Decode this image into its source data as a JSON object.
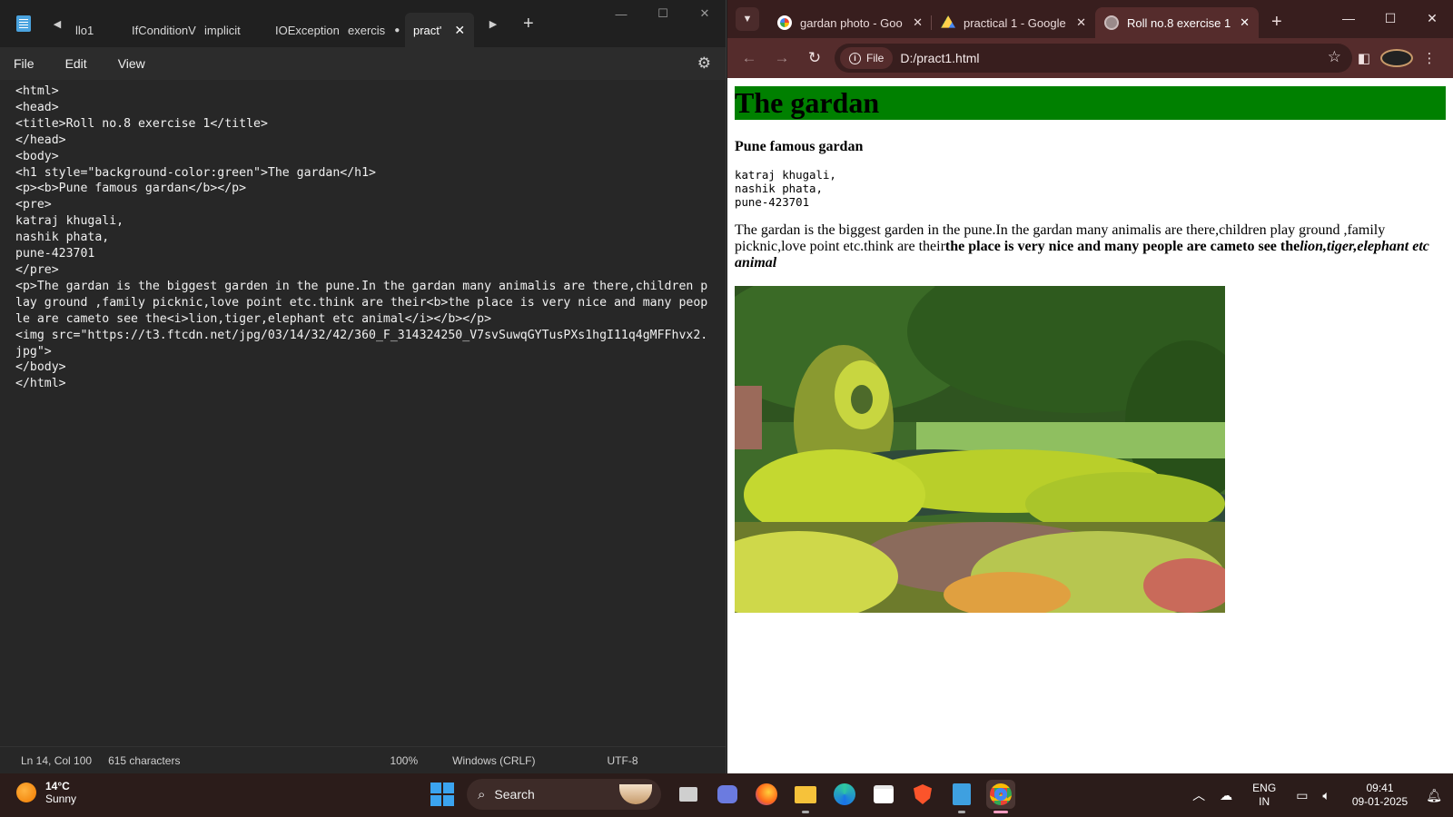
{
  "notepad": {
    "tabs": [
      {
        "label": "llo1",
        "active": false
      },
      {
        "label": "IfConditionV",
        "active": false
      },
      {
        "label": "implicit",
        "active": false
      },
      {
        "label": "IOException",
        "active": false
      },
      {
        "label": "exercis",
        "active": false,
        "unsaved": true
      },
      {
        "label": "pract'",
        "active": true
      }
    ],
    "menu": {
      "file": "File",
      "edit": "Edit",
      "view": "View"
    },
    "code": "<html>\n<head>\n<title>Roll no.8 exercise 1</title>\n</head>\n<body>\n<h1 style=\"background-color:green\">The gardan</h1>\n<p><b>Pune famous gardan</b></p>\n<pre>\nkatraj khugali,\nnashik phata,\npune-423701\n</pre>\n<p>The gardan is the biggest garden in the pune.In the gardan many animalis are there,children play ground ,family picknic,love point etc.think are their<b>the place is very nice and many people are cameto see the<i>lion,tiger,elephant etc animal</i></b></p>\n<img src=\"https://t3.ftcdn.net/jpg/03/14/32/42/360_F_314324250_V7svSuwqGYTusPXs1hgI11q4gMFFhvx2.jpg\">\n</body>\n</html>",
    "status": {
      "position": "Ln 14, Col 100",
      "chars": "615 characters",
      "zoom": "100%",
      "eol": "Windows (CRLF)",
      "encoding": "UTF-8"
    }
  },
  "chrome": {
    "tabs": [
      {
        "title": "gardan photo - Goo",
        "favicon": "google-icon",
        "active": false
      },
      {
        "title": "practical 1 - Google",
        "favicon": "google-drive-icon",
        "active": false
      },
      {
        "title": "Roll no.8 exercise 1",
        "favicon": "globe-icon",
        "active": true
      }
    ],
    "omnibox": {
      "chip": "File",
      "url": "D:/pract1.html"
    },
    "page": {
      "h1": "The gardan",
      "subtitle": "Pune famous gardan",
      "address": "katraj khugali,\nnashik phata,\npune-423701",
      "para_plain": "The gardan is the biggest garden in the pune.In the gardan many animalis are there,children play ground ,family picknic,love point etc.think are their",
      "para_bold": "the place is very nice and many people are cameto see the",
      "para_bold_italic": "lion,tiger,elephant etc animal",
      "h1_bg": "#008000"
    }
  },
  "taskbar": {
    "weather": {
      "temp": "14°C",
      "condition": "Sunny"
    },
    "search_label": "Search",
    "apps": [
      "file-explorer-icon",
      "meet-icon",
      "firefox-icon",
      "folder-icon",
      "edge-icon",
      "store-icon",
      "brave-icon",
      "notepad-icon",
      "chrome-icon"
    ],
    "lang": {
      "line1": "ENG",
      "line2": "IN"
    },
    "time": "09:41",
    "date": "09-01-2025"
  }
}
